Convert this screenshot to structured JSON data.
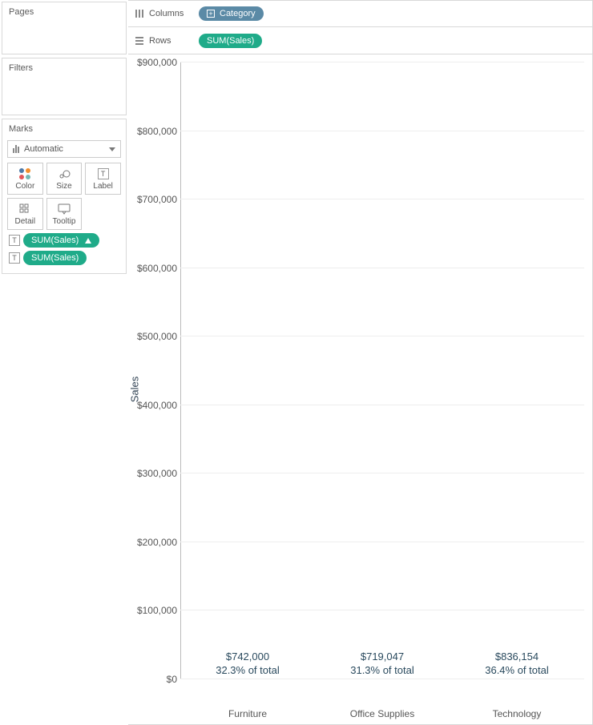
{
  "panels": {
    "pages": "Pages",
    "filters": "Filters",
    "marks": "Marks"
  },
  "marks": {
    "type_label": "Automatic",
    "buttons": {
      "color": "Color",
      "size": "Size",
      "label": "Label",
      "detail": "Detail",
      "tooltip": "Tooltip"
    },
    "pills": {
      "sum_sales_delta": "SUM(Sales)",
      "sum_sales": "SUM(Sales)"
    }
  },
  "shelves": {
    "columns_label": "Columns",
    "rows_label": "Rows",
    "columns_pill": "Category",
    "rows_pill": "SUM(Sales)"
  },
  "chart_data": {
    "type": "bar",
    "ylabel": "Sales",
    "categories": [
      "Furniture",
      "Office Supplies",
      "Technology"
    ],
    "values": [
      742000,
      719047,
      836154
    ],
    "data_labels_value": [
      "$742,000",
      "$719,047",
      "$836,154"
    ],
    "data_labels_pct": [
      "32.3% of total",
      "31.3% of total",
      "36.4% of total"
    ],
    "y_ticks": [
      "$0",
      "$100,000",
      "$200,000",
      "$300,000",
      "$400,000",
      "$500,000",
      "$600,000",
      "$700,000",
      "$800,000",
      "$900,000"
    ],
    "ylim": [
      0,
      900000
    ]
  }
}
